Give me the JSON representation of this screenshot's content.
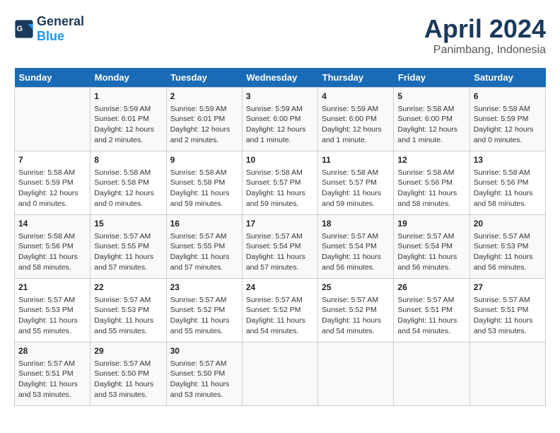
{
  "header": {
    "logo_line1": "General",
    "logo_line2": "Blue",
    "title": "April 2024",
    "subtitle": "Panimbang, Indonesia"
  },
  "columns": [
    "Sunday",
    "Monday",
    "Tuesday",
    "Wednesday",
    "Thursday",
    "Friday",
    "Saturday"
  ],
  "weeks": [
    [
      {
        "day": "",
        "info": ""
      },
      {
        "day": "1",
        "info": "Sunrise: 5:59 AM\nSunset: 6:01 PM\nDaylight: 12 hours\nand 2 minutes."
      },
      {
        "day": "2",
        "info": "Sunrise: 5:59 AM\nSunset: 6:01 PM\nDaylight: 12 hours\nand 2 minutes."
      },
      {
        "day": "3",
        "info": "Sunrise: 5:59 AM\nSunset: 6:00 PM\nDaylight: 12 hours\nand 1 minute."
      },
      {
        "day": "4",
        "info": "Sunrise: 5:59 AM\nSunset: 6:00 PM\nDaylight: 12 hours\nand 1 minute."
      },
      {
        "day": "5",
        "info": "Sunrise: 5:58 AM\nSunset: 6:00 PM\nDaylight: 12 hours\nand 1 minute."
      },
      {
        "day": "6",
        "info": "Sunrise: 5:58 AM\nSunset: 5:59 PM\nDaylight: 12 hours\nand 0 minutes."
      }
    ],
    [
      {
        "day": "7",
        "info": "Sunrise: 5:58 AM\nSunset: 5:59 PM\nDaylight: 12 hours\nand 0 minutes."
      },
      {
        "day": "8",
        "info": "Sunrise: 5:58 AM\nSunset: 5:58 PM\nDaylight: 12 hours\nand 0 minutes."
      },
      {
        "day": "9",
        "info": "Sunrise: 5:58 AM\nSunset: 5:58 PM\nDaylight: 11 hours\nand 59 minutes."
      },
      {
        "day": "10",
        "info": "Sunrise: 5:58 AM\nSunset: 5:57 PM\nDaylight: 11 hours\nand 59 minutes."
      },
      {
        "day": "11",
        "info": "Sunrise: 5:58 AM\nSunset: 5:57 PM\nDaylight: 11 hours\nand 59 minutes."
      },
      {
        "day": "12",
        "info": "Sunrise: 5:58 AM\nSunset: 5:56 PM\nDaylight: 11 hours\nand 58 minutes."
      },
      {
        "day": "13",
        "info": "Sunrise: 5:58 AM\nSunset: 5:56 PM\nDaylight: 11 hours\nand 58 minutes."
      }
    ],
    [
      {
        "day": "14",
        "info": "Sunrise: 5:58 AM\nSunset: 5:56 PM\nDaylight: 11 hours\nand 58 minutes."
      },
      {
        "day": "15",
        "info": "Sunrise: 5:57 AM\nSunset: 5:55 PM\nDaylight: 11 hours\nand 57 minutes."
      },
      {
        "day": "16",
        "info": "Sunrise: 5:57 AM\nSunset: 5:55 PM\nDaylight: 11 hours\nand 57 minutes."
      },
      {
        "day": "17",
        "info": "Sunrise: 5:57 AM\nSunset: 5:54 PM\nDaylight: 11 hours\nand 57 minutes."
      },
      {
        "day": "18",
        "info": "Sunrise: 5:57 AM\nSunset: 5:54 PM\nDaylight: 11 hours\nand 56 minutes."
      },
      {
        "day": "19",
        "info": "Sunrise: 5:57 AM\nSunset: 5:54 PM\nDaylight: 11 hours\nand 56 minutes."
      },
      {
        "day": "20",
        "info": "Sunrise: 5:57 AM\nSunset: 5:53 PM\nDaylight: 11 hours\nand 56 minutes."
      }
    ],
    [
      {
        "day": "21",
        "info": "Sunrise: 5:57 AM\nSunset: 5:53 PM\nDaylight: 11 hours\nand 55 minutes."
      },
      {
        "day": "22",
        "info": "Sunrise: 5:57 AM\nSunset: 5:53 PM\nDaylight: 11 hours\nand 55 minutes."
      },
      {
        "day": "23",
        "info": "Sunrise: 5:57 AM\nSunset: 5:52 PM\nDaylight: 11 hours\nand 55 minutes."
      },
      {
        "day": "24",
        "info": "Sunrise: 5:57 AM\nSunset: 5:52 PM\nDaylight: 11 hours\nand 54 minutes."
      },
      {
        "day": "25",
        "info": "Sunrise: 5:57 AM\nSunset: 5:52 PM\nDaylight: 11 hours\nand 54 minutes."
      },
      {
        "day": "26",
        "info": "Sunrise: 5:57 AM\nSunset: 5:51 PM\nDaylight: 11 hours\nand 54 minutes."
      },
      {
        "day": "27",
        "info": "Sunrise: 5:57 AM\nSunset: 5:51 PM\nDaylight: 11 hours\nand 53 minutes."
      }
    ],
    [
      {
        "day": "28",
        "info": "Sunrise: 5:57 AM\nSunset: 5:51 PM\nDaylight: 11 hours\nand 53 minutes."
      },
      {
        "day": "29",
        "info": "Sunrise: 5:57 AM\nSunset: 5:50 PM\nDaylight: 11 hours\nand 53 minutes."
      },
      {
        "day": "30",
        "info": "Sunrise: 5:57 AM\nSunset: 5:50 PM\nDaylight: 11 hours\nand 53 minutes."
      },
      {
        "day": "",
        "info": ""
      },
      {
        "day": "",
        "info": ""
      },
      {
        "day": "",
        "info": ""
      },
      {
        "day": "",
        "info": ""
      }
    ]
  ]
}
